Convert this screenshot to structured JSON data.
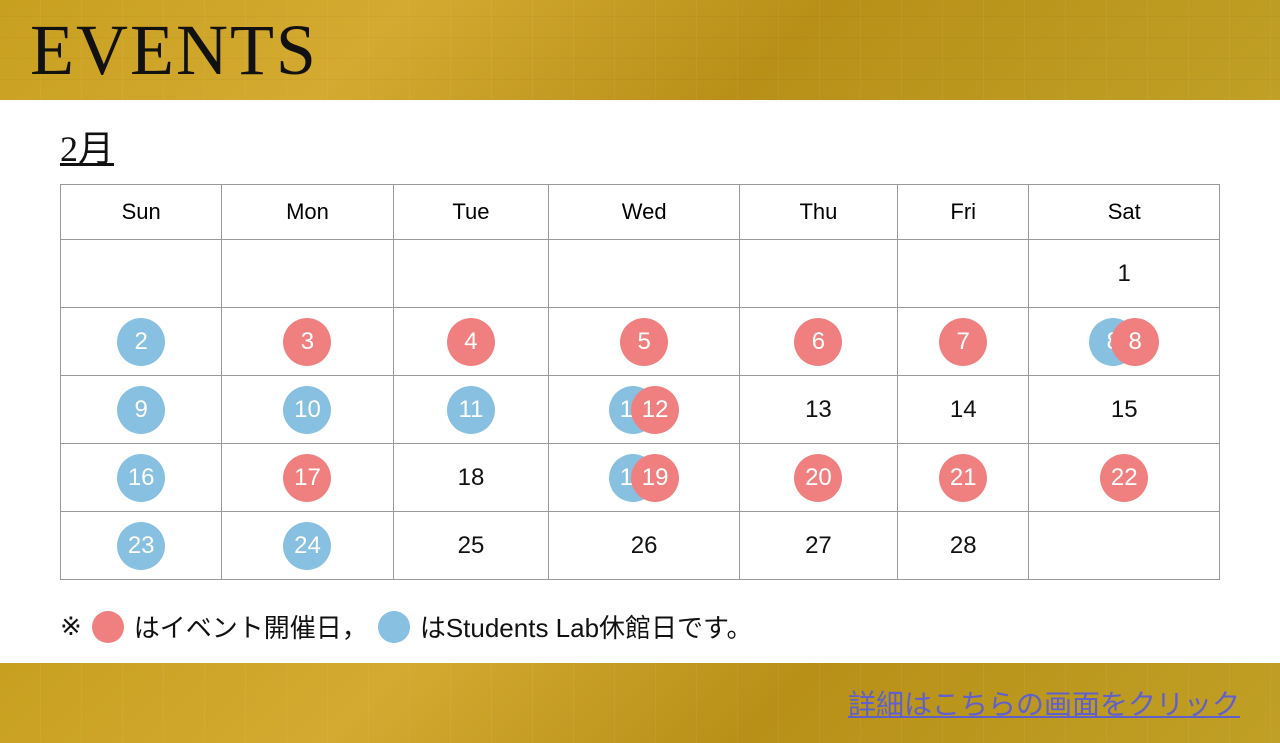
{
  "header": {
    "title": "EVENTS"
  },
  "calendar": {
    "month_label": "2月",
    "days_of_week": [
      "Sun",
      "Mon",
      "Tue",
      "Wed",
      "Thu",
      "Fri",
      "Sat"
    ],
    "weeks": [
      [
        {
          "day": "",
          "type": "empty"
        },
        {
          "day": "",
          "type": "empty"
        },
        {
          "day": "",
          "type": "empty"
        },
        {
          "day": "",
          "type": "empty"
        },
        {
          "day": "",
          "type": "empty"
        },
        {
          "day": "",
          "type": "empty"
        },
        {
          "day": "1",
          "type": "plain"
        }
      ],
      [
        {
          "day": "2",
          "type": "blue"
        },
        {
          "day": "3",
          "type": "red"
        },
        {
          "day": "4",
          "type": "red"
        },
        {
          "day": "5",
          "type": "red"
        },
        {
          "day": "6",
          "type": "red"
        },
        {
          "day": "7",
          "type": "red"
        },
        {
          "day": "8",
          "type": "both"
        }
      ],
      [
        {
          "day": "9",
          "type": "blue"
        },
        {
          "day": "10",
          "type": "blue"
        },
        {
          "day": "11",
          "type": "blue"
        },
        {
          "day": "12",
          "type": "both"
        },
        {
          "day": "13",
          "type": "plain"
        },
        {
          "day": "14",
          "type": "plain"
        },
        {
          "day": "15",
          "type": "plain"
        }
      ],
      [
        {
          "day": "16",
          "type": "blue"
        },
        {
          "day": "17",
          "type": "red"
        },
        {
          "day": "18",
          "type": "plain"
        },
        {
          "day": "19",
          "type": "both"
        },
        {
          "day": "20",
          "type": "red"
        },
        {
          "day": "21",
          "type": "red"
        },
        {
          "day": "22",
          "type": "red"
        }
      ],
      [
        {
          "day": "23",
          "type": "blue"
        },
        {
          "day": "24",
          "type": "blue"
        },
        {
          "day": "25",
          "type": "plain"
        },
        {
          "day": "26",
          "type": "plain"
        },
        {
          "day": "27",
          "type": "plain"
        },
        {
          "day": "28",
          "type": "plain"
        },
        {
          "day": "",
          "type": "empty"
        }
      ]
    ]
  },
  "legend": {
    "prefix": "※",
    "red_label": "はイベント開催日，",
    "blue_label": "はStudents Lab休館日です。"
  },
  "footer": {
    "link_text": "詳細はこちらの画面をクリック"
  }
}
